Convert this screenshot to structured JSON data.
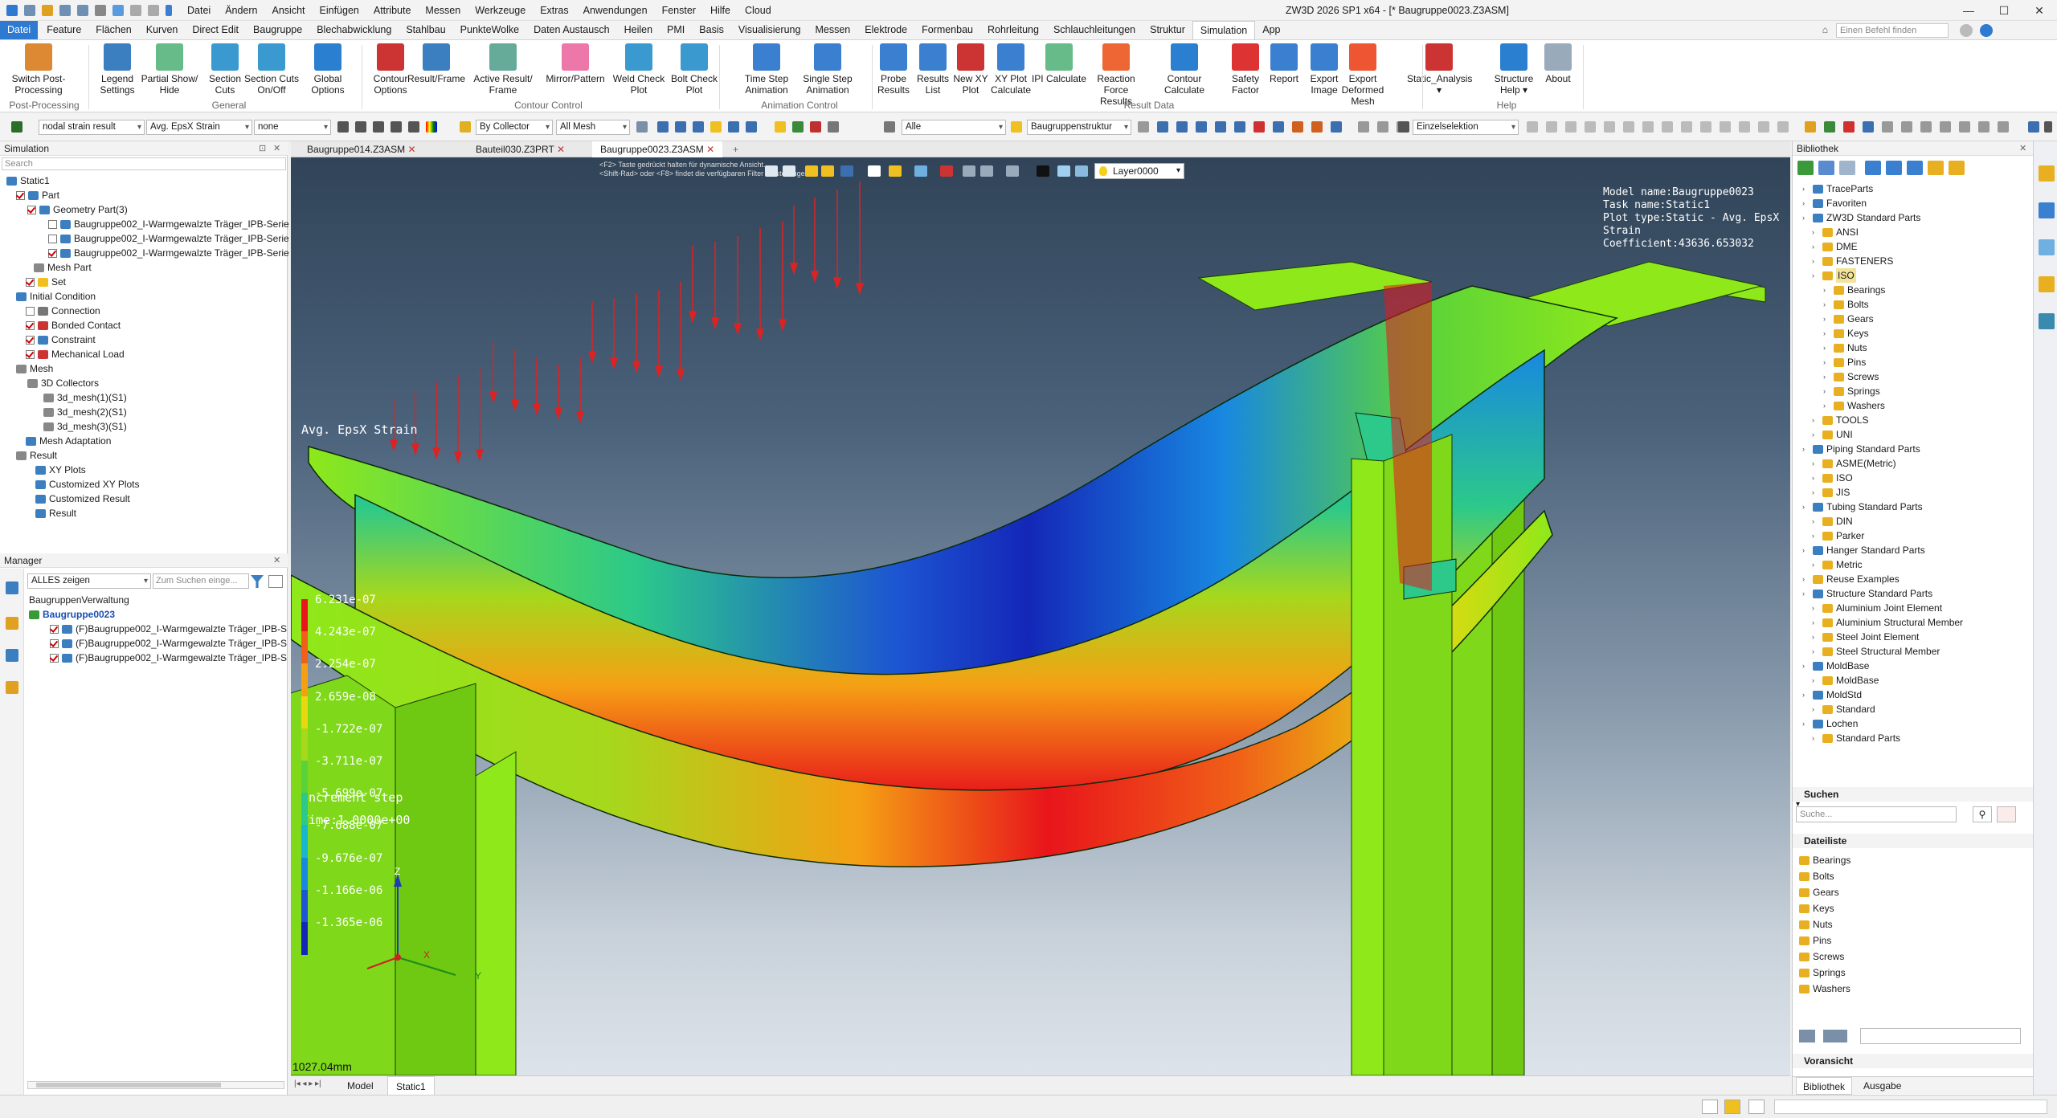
{
  "app": {
    "title": "ZW3D 2026 SP1 x64 - [* Baugruppe0023.Z3ASM]"
  },
  "menubar": [
    "Datei",
    "Ändern",
    "Ansicht",
    "Einfügen",
    "Attribute",
    "Messen",
    "Werkzeuge",
    "Extras",
    "Anwendungen",
    "Fenster",
    "Hilfe",
    "Cloud"
  ],
  "ribbon_tabs": [
    "Datei",
    "Feature",
    "Flächen",
    "Kurven",
    "Direct Edit",
    "Baugruppe",
    "Blechabwicklung",
    "Stahlbau",
    "PunkteWolke",
    "Daten Austausch",
    "Heilen",
    "PMI",
    "Basis",
    "Visualisierung",
    "Messen",
    "Elektrode",
    "Formenbau",
    "Rohrleitung",
    "Schlauchleitungen",
    "Struktur",
    "Simulation",
    "App"
  ],
  "command_search": {
    "placeholder": "Einen Befehl finden"
  },
  "ribbon": {
    "buttons": [
      {
        "l1": "Switch Post-",
        "l2": "Processing",
        "icon": "switch-postprocessing-icon"
      },
      {
        "l1": "Legend",
        "l2": "Settings",
        "icon": "legend-settings-icon"
      },
      {
        "l1": "Partial Show/",
        "l2": "Hide",
        "icon": "partial-show-icon"
      },
      {
        "l1": "Section",
        "l2": "Cuts",
        "icon": "section-cuts-icon"
      },
      {
        "l1": "Section Cuts",
        "l2": "On/Off",
        "icon": "section-onoff-icon"
      },
      {
        "l1": "Global",
        "l2": "Options",
        "icon": "global-options-icon"
      },
      {
        "l1": "Contour",
        "l2": "Options",
        "icon": "contour-options-icon"
      },
      {
        "l1": "Result/Frame",
        "l2": "",
        "icon": "result-frame-icon"
      },
      {
        "l1": "Active Result/",
        "l2": "Frame",
        "icon": "active-result-icon"
      },
      {
        "l1": "Mirror/Pattern",
        "l2": "",
        "icon": "mirror-icon"
      },
      {
        "l1": "Weld Check",
        "l2": "Plot",
        "icon": "weld-check-icon"
      },
      {
        "l1": "Bolt Check",
        "l2": "Plot",
        "icon": "bolt-check-icon"
      },
      {
        "l1": "Time Step",
        "l2": "Animation",
        "icon": "time-step-icon"
      },
      {
        "l1": "Single Step",
        "l2": "Animation",
        "icon": "single-step-icon"
      },
      {
        "l1": "Probe",
        "l2": "Results",
        "icon": "probe-icon"
      },
      {
        "l1": "Results",
        "l2": "List",
        "icon": "results-list-icon"
      },
      {
        "l1": "New XY",
        "l2": "Plot",
        "icon": "xy-plot-icon"
      },
      {
        "l1": "XY Plot",
        "l2": "Calculate",
        "icon": "xy-calc-icon"
      },
      {
        "l1": "IPI Calculate",
        "l2": "",
        "icon": "ipi-icon"
      },
      {
        "l1": "Reaction Force",
        "l2": "Results",
        "icon": "reaction-force-icon"
      },
      {
        "l1": "Contour",
        "l2": "Calculate",
        "icon": "contour-calc-icon"
      },
      {
        "l1": "Safety",
        "l2": "Factor",
        "icon": "safety-factor-icon"
      },
      {
        "l1": "Report",
        "l2": "",
        "icon": "report-icon"
      },
      {
        "l1": "Export",
        "l2": "Image",
        "icon": "export-image-icon"
      },
      {
        "l1": "Export Deformed",
        "l2": "Mesh",
        "icon": "export-mesh-icon"
      },
      {
        "l1": "Static_Analysis",
        "l2": "▾",
        "icon": "static-analysis-icon"
      },
      {
        "l1": "Structure",
        "l2": "Help ▾",
        "icon": "help-icon"
      },
      {
        "l1": "About",
        "l2": "",
        "icon": "about-icon"
      }
    ],
    "groups": [
      "Post-Processing",
      "General",
      "Contour Control",
      "Animation Control",
      "Result Data",
      "Help"
    ]
  },
  "toolbar": {
    "result_type": "nodal strain result",
    "component": "Avg. EpsX Strain",
    "deform": "none",
    "collector": "By Collector",
    "mesh": "All Mesh",
    "filter": "Alle",
    "structure": "Baugruppenstruktur",
    "selection": "Einzelselektion"
  },
  "left": {
    "sim_title": "Simulation",
    "search": "Search",
    "tree": [
      "Static1",
      "Part",
      "Geometry Part(3)",
      "Baugruppe002_I-Warmgewalzte Träger_IPB-Serie",
      "Baugruppe002_I-Warmgewalzte Träger_IPB-Serie",
      "Baugruppe002_I-Warmgewalzte Träger_IPB-Serie",
      "Mesh Part",
      "Set",
      "Initial Condition",
      "Connection",
      "Bonded Contact",
      "Constraint",
      "Mechanical Load",
      "Mesh",
      "3D Collectors",
      "3d_mesh(1)(S1)",
      "3d_mesh(2)(S1)",
      "3d_mesh(3)(S1)",
      "Mesh Adaptation",
      "Result",
      "XY Plots",
      "Customized XY Plots",
      "Customized Result",
      "Result"
    ],
    "manager_title": "Manager",
    "manager_filter": "ALLES zeigen",
    "manager_search": "Zum Suchen einge...",
    "manager_tree": [
      "BaugruppenVerwaltung",
      "Baugruppe0023",
      "(F)Baugruppe002_I-Warmgewalzte Träger_IPB-S",
      "(F)Baugruppe002_I-Warmgewalzte Träger_IPB-S",
      "(F)Baugruppe002_I-Warmgewalzte Träger_IPB-S"
    ]
  },
  "doc_tabs": [
    "Baugruppe014.Z3ASM",
    "Bauteil030.Z3PRT",
    "Baugruppe0023.Z3ASM"
  ],
  "viewport": {
    "hint1": "<F2> Taste gedrückt halten für dynamische Ansicht.",
    "hint2": "<Shift-Rad> oder <F8> findet die verfügbaren Filter Einstellungen.",
    "layer": "Layer0000",
    "legend_title": "Avg. EpsX Strain",
    "legend_values": [
      "6.231e-07",
      "4.243e-07",
      "2.254e-07",
      "2.659e-08",
      "-1.722e-07",
      "-3.711e-07",
      "-5.699e-07",
      "-7.688e-07",
      "-9.676e-07",
      "-1.166e-06",
      "-1.365e-06"
    ],
    "legend_colors": [
      "#e8151b",
      "#f06018",
      "#f5a014",
      "#e7d810",
      "#a6d81c",
      "#5ad33a",
      "#2cc98a",
      "#19b6d0",
      "#1888e0",
      "#1d55d2",
      "#1427b8"
    ],
    "increment": "Increment step",
    "time": "Time:1.0000e+00",
    "info": [
      "Model name:Baugruppe0023",
      "Task name:Static1",
      "Plot type:Static - Avg. EpsX Strain",
      "Coefficient:43636.653032"
    ],
    "scale": "1027.04mm",
    "axes": {
      "z": "Z",
      "x": "X",
      "y": "Y"
    }
  },
  "bottom_tabs": [
    "Model",
    "Static1"
  ],
  "right": {
    "title": "Bibliothek",
    "tree": [
      "TraceParts",
      "Favoriten",
      "ZW3D Standard Parts",
      "ANSI",
      "DME",
      "FASTENERS",
      "ISO",
      "Bearings",
      "Bolts",
      "Gears",
      "Keys",
      "Nuts",
      "Pins",
      "Screws",
      "Springs",
      "Washers",
      "TOOLS",
      "UNI",
      "Piping Standard Parts",
      "ASME(Metric)",
      "ISO",
      "JIS",
      "Tubing Standard Parts",
      "DIN",
      "Parker",
      "Hanger Standard Parts",
      "Metric",
      "Reuse Examples",
      "Structure Standard Parts",
      "Aluminium Joint Element",
      "Aluminium Structural Member",
      "Steel Joint Element",
      "Steel Structural Member",
      "MoldBase",
      "MoldBase",
      "MoldStd",
      "Standard",
      "Lochen",
      "Standard Parts"
    ],
    "search_title": "Suchen",
    "search_placeholder": "Suche...",
    "filelist_title": "Dateiliste",
    "files": [
      "Bearings",
      "Bolts",
      "Gears",
      "Keys",
      "Nuts",
      "Pins",
      "Screws",
      "Springs",
      "Washers"
    ],
    "preview": "Voransicht",
    "tabs": [
      "Bibliothek",
      "Ausgabe"
    ]
  }
}
